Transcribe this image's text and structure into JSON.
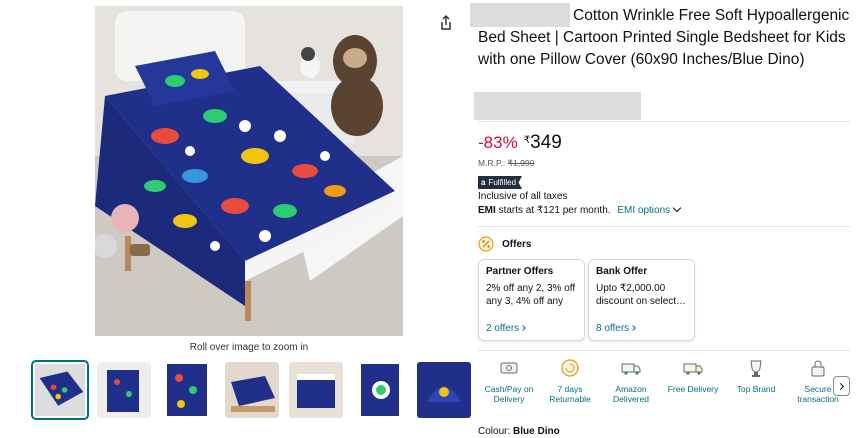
{
  "main_image": {
    "zoom_hint": "Roll over image to zoom in"
  },
  "thumbnails": [
    {
      "name": "thumb-1",
      "selected": true
    },
    {
      "name": "thumb-2",
      "selected": false
    },
    {
      "name": "thumb-3",
      "selected": false
    },
    {
      "name": "thumb-4",
      "selected": false
    },
    {
      "name": "thumb-5",
      "selected": false
    },
    {
      "name": "thumb-6",
      "selected": false
    },
    {
      "name": "thumb-7",
      "selected": false
    }
  ],
  "product": {
    "title": "Cotton Wrinkle Free Soft Hypoallergenic Bed Sheet | Cartoon Printed Single Bedsheet for Kids with one Pillow Cover (60x90 Inches/Blue Dino)",
    "discount": "-83%",
    "currency_symbol": "₹",
    "price": "349",
    "mrp_label": "M.R.P.:",
    "mrp_value": "₹1,999",
    "fulfilled_label": "Fulfilled",
    "taxes_text": "Inclusive of all taxes",
    "emi_label": "EMI",
    "emi_text": "starts at ₹121 per month.",
    "emi_options": "EMI options"
  },
  "offers": {
    "title": "Offers",
    "cards": [
      {
        "title": "Partner Offers",
        "body": "2% off any 2, 3% off any 3, 4% off any",
        "link": "2 offers"
      },
      {
        "title": "Bank Offer",
        "body": "Upto ₹2,000.00 discount on select…",
        "link": "8 offers"
      }
    ]
  },
  "features": [
    {
      "label_1": "Cash/Pay on",
      "label_2": "Delivery",
      "icon": "cash-on-delivery-icon"
    },
    {
      "label_1": "7 days",
      "label_2": "Returnable",
      "icon": "returnable-icon"
    },
    {
      "label_1": "Amazon",
      "label_2": "Delivered",
      "icon": "amazon-delivered-icon"
    },
    {
      "label_1": "Free Delivery",
      "label_2": "",
      "icon": "free-delivery-icon"
    },
    {
      "label_1": "Top Brand",
      "label_2": "",
      "icon": "top-brand-icon"
    },
    {
      "label_1": "Secure",
      "label_2": "transaction",
      "icon": "secure-transaction-icon"
    }
  ],
  "colour": {
    "label": "Colour:",
    "value": "Blue Dino"
  },
  "colors": {
    "link": "#007185",
    "discount": "#cc0c39",
    "sheet_blue": "#1f2f8a",
    "badge": "#232f3e"
  }
}
